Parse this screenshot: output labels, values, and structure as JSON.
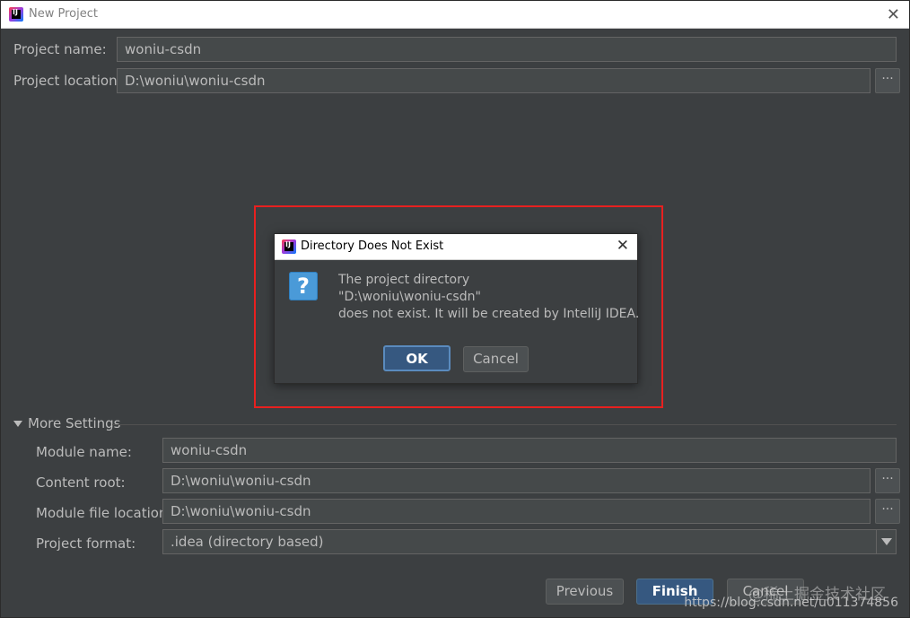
{
  "window": {
    "title": "New Project"
  },
  "project": {
    "name_label": "Project name:",
    "name_value": "woniu-csdn",
    "location_label": "Project location:",
    "location_value": "D:\\woniu\\woniu-csdn",
    "browse_label": "···"
  },
  "more_settings": {
    "header": "More Settings",
    "module_name_label": "Module name:",
    "module_name_value": "woniu-csdn",
    "content_root_label": "Content root:",
    "content_root_value": "D:\\woniu\\woniu-csdn",
    "module_file_label": "Module file location:",
    "module_file_value": "D:\\woniu\\woniu-csdn",
    "format_label": "Project format:",
    "format_value": ".idea (directory based)"
  },
  "buttons": {
    "previous": "Previous",
    "finish": "Finish",
    "cancel": "Cancel"
  },
  "dialog": {
    "title": "Directory Does Not Exist",
    "line1": "The project directory",
    "line2": "\"D:\\woniu\\woniu-csdn\"",
    "line3": "does not exist. It will be created by IntelliJ IDEA.",
    "ok": "OK",
    "cancel": "Cancel"
  },
  "watermark": {
    "site": "@稀土掘金技术社区",
    "url": "https://blog.csdn.net/u011374856"
  },
  "colors": {
    "background": "#3c3f41",
    "highlight": "#e8201f",
    "primary_button": "#365880",
    "question_icon": "#4a9ad8"
  }
}
